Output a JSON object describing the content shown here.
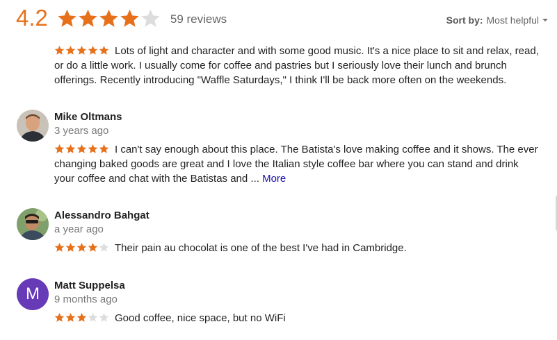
{
  "summary": {
    "rating": "4.2",
    "rating_value": 4.2,
    "star_count": 5,
    "review_count": "59 reviews"
  },
  "sort": {
    "label": "Sort by:",
    "value": "Most helpful",
    "icon": "chevron-down-icon"
  },
  "colors": {
    "accent": "#e7711b",
    "star_empty": "#dddddd",
    "link": "#1a0dab",
    "avatar_letter_bg": "#673ab7"
  },
  "reviews": [
    {
      "name": "",
      "time": "",
      "stars": 5,
      "text": "Lots of light and character and with some good music. It's a nice place to sit and relax, read, or do a little work. I usually come for coffee and pastries but I seriously love their lunch and brunch offerings. Recently introducing \"Waffle Saturdays,\" I think I'll be back more often on the weekends.",
      "more": ""
    },
    {
      "name": "Mike Oltmans",
      "time": "3 years ago",
      "stars": 5,
      "text": "I can't say enough about this place. The Batista's love making coffee and it shows.  The ever changing baked goods are great and I love the Italian style coffee bar where you can stand and drink your coffee and chat with the Batistas and ...",
      "more": "More"
    },
    {
      "name": "Alessandro Bahgat",
      "time": "a year ago",
      "stars": 4,
      "text": "Their pain au chocolat is one of the best I've had in Cambridge.",
      "more": ""
    },
    {
      "name": "Matt Suppelsa",
      "time": "9 months ago",
      "stars": 3,
      "avatar_letter": "M",
      "text": "Good coffee, nice space, but no WiFi",
      "more": ""
    }
  ]
}
